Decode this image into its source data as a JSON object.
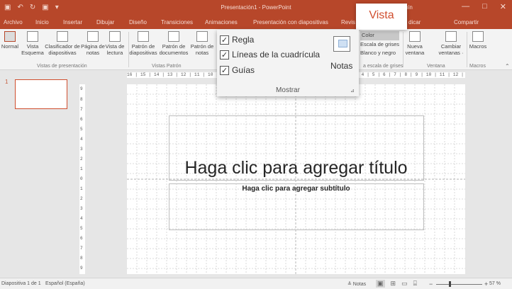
{
  "window": {
    "title": "Presentación1  -  PowerPoint",
    "user": "s Holguín",
    "qat": [
      "▣",
      "↶",
      "↻",
      "▣",
      "▾"
    ],
    "controls": [
      "—",
      "□",
      "✕"
    ]
  },
  "tabs": [
    "Archivo",
    "Inicio",
    "Insertar",
    "Dibujar",
    "Diseño",
    "Transiciones",
    "Animaciones",
    "Presentación con diapositivas",
    "Revis",
    "Vista",
    "dicar"
  ],
  "share_label": "Compartir",
  "ribbon": {
    "buttons": [
      "Normal",
      "Vista Esquema",
      "Clasificador de diapositivas",
      "Página de notas",
      "Vista de lectura",
      "Patrón de diapositivas",
      "Patrón de documentos",
      "Patrón de notas",
      "Nueva ventana",
      "Cambiar ventanas ·",
      "Macros"
    ],
    "color_options": [
      "Color",
      "Escala de grises",
      "Blanco y negro"
    ],
    "groups": [
      "Vistas de presentación",
      "Vistas Patrón",
      "a escala de grises",
      "Ventana",
      "Macros"
    ]
  },
  "show_popup": {
    "vista_tab": "Vista",
    "checkboxes": [
      {
        "label": "Regla",
        "checked": true
      },
      {
        "label": "Líneas de la cuadrícula",
        "checked": true
      },
      {
        "label": "Guías",
        "checked": true
      }
    ],
    "notes_label": "Notas",
    "group_label": "Mostrar"
  },
  "thumbnail_number": "1",
  "ruler": {
    "horizontal": "16 | 15 | 14 | 13 | 12 | 11 | 10 | 9 | 8 | 7 | 6 | 5 | 4 | 3 | 2 | 1 | 0 | 1 | 2 | 3 | 4 | 5 | 6 | 7 | 8 | 9 | 10 | 11 | 12 | 13 | 14 | 15 | 16",
    "vertical": [
      "9",
      "8",
      "7",
      "6",
      "5",
      "4",
      "3",
      "2",
      "1",
      "0",
      "1",
      "2",
      "3",
      "4",
      "5",
      "6",
      "7",
      "8",
      "9"
    ]
  },
  "slide": {
    "title_placeholder": "Haga clic para agregar título",
    "subtitle_placeholder": "Haga clic para agregar subtítulo"
  },
  "status": {
    "slide_info": "Diapositiva 1 de 1",
    "language": "Español (España)",
    "notes": "≜ Notas",
    "zoom": "57 %",
    "zoom_minus": "−",
    "zoom_plus": "+",
    "zoom_level": 0.57,
    "view_icons": [
      "▣",
      "⊞",
      "▭",
      "⌸"
    ]
  },
  "colors": {
    "accent": "#b7472a",
    "accent_text": "#d04e2e"
  }
}
